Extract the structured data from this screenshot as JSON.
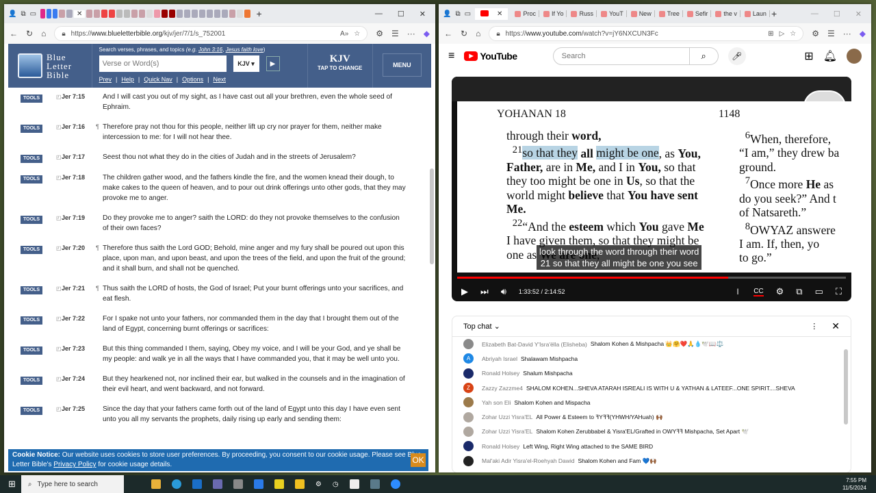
{
  "left_browser": {
    "url_prefix": "https://",
    "url_host": "www.blueletterbible.org",
    "url_path": "/kjv/jer/7/1/s_752001",
    "logo": [
      "Blue",
      "Letter",
      "Bible"
    ],
    "search_hint": "Search verses, phrases, and topics",
    "search_hint_eg": "(e.g.",
    "search_example1": "John 3:16",
    "search_example2": "Jesus faith love",
    "search_placeholder": "Verse or Word(s)",
    "version_select": "KJV ▾",
    "nav": [
      "Prev",
      "Help",
      "Quick Nav",
      "Options",
      "Next"
    ],
    "version_big": "KJV",
    "tap_to_change": "TAP TO CHANGE",
    "menu": "MENU",
    "tools_label": "TOOLS",
    "verses": [
      {
        "ref": "Jer 7:15",
        "para": "",
        "text": "And I will cast you out of my sight, as I have cast out all your brethren, even the whole seed of Ephraim."
      },
      {
        "ref": "Jer 7:16",
        "para": "¶",
        "text": "Therefore pray not thou for this people, neither lift up cry nor prayer for them, neither make intercession to me: for I will not hear thee."
      },
      {
        "ref": "Jer 7:17",
        "para": "",
        "text": "Seest thou not what they do in the cities of Judah and in the streets of Jerusalem?"
      },
      {
        "ref": "Jer 7:18",
        "para": "",
        "text": "The children gather wood, and the fathers kindle the fire, and the women knead their dough, to make cakes to the queen of heaven, and to pour out drink offerings unto other gods, that they may provoke me to anger."
      },
      {
        "ref": "Jer 7:19",
        "para": "",
        "text": "Do they provoke me to anger? saith the LORD: do they not provoke themselves to the confusion of their own faces?"
      },
      {
        "ref": "Jer 7:20",
        "para": "¶",
        "text": "Therefore thus saith the Lord GOD; Behold, mine anger and my fury shall be poured out upon this place, upon man, and upon beast, and upon the trees of the field, and upon the fruit of the ground; and it shall burn, and shall not be quenched."
      },
      {
        "ref": "Jer 7:21",
        "para": "¶",
        "text": "Thus saith the LORD of hosts, the God of Israel; Put your burnt offerings unto your sacrifices, and eat flesh."
      },
      {
        "ref": "Jer 7:22",
        "para": "",
        "text": "For I spake not unto your fathers, nor commanded them in the day that I brought them out of the land of Egypt, concerning burnt offerings or sacrifices:"
      },
      {
        "ref": "Jer 7:23",
        "para": "",
        "text": "But this thing commanded I them, saying, Obey my voice, and I will be your God, and ye shall be my people: and walk ye in all the ways that I have commanded you, that it may be well unto you."
      },
      {
        "ref": "Jer 7:24",
        "para": "",
        "text": "But they hearkened not, nor inclined their ear, but walked in the counsels and in the imagination of their evil heart, and went backward, and not forward."
      },
      {
        "ref": "Jer 7:25",
        "para": "",
        "text": "Since the day that your fathers came forth out of the land of Egypt unto this day I have even sent unto you all my servants the prophets, daily rising up early and sending them:"
      }
    ],
    "cookie_title": "Cookie Notice:",
    "cookie_text": "Our website uses cookies to store user preferences. By proceeding, you consent to our cookie usage. Please see Blue Letter Bible's",
    "cookie_link": "Privacy Policy",
    "cookie_tail": "for cookie usage details.",
    "cookie_ok": "OK"
  },
  "right_browser": {
    "tabs": [
      "Proc",
      "If Yo",
      "Russ",
      "YouT",
      "New",
      "Tree",
      "Sefir",
      "the v",
      "Laun"
    ],
    "url_prefix": "https://",
    "url_host": "www.youtube.com",
    "url_path": "/watch?v=jY6NXCUN3Fc",
    "brand": "YouTube",
    "search_placeholder": "Search",
    "video": {
      "page_header": "YOHANAN 18",
      "page_number": "1148",
      "col1_html": "through their <b>word,</b><br>&nbsp;&nbsp;<sup>21</sup><span class=\"hl\">so that they</span> <b>all</b> <span class=\"hl\">might be one</span>, as <b>You,<br>Father,</b> are in <b>Me,</b> and I in <b>You,</b> so that<br>they too might be one in <b>Us</b>, so that the<br>world might <b>believe</b> that <b>You have sent<br>Me.</b><br>&nbsp;&nbsp;<sup>22</sup>“And the <b>esteem</b> which <b>You</b> gave <b>Me</b><br>I have given them, so that they might be<br>one as <b>We are one</b>,",
      "col2_html": "&nbsp;&nbsp;<sup>6</sup>When, therefore,<br>“I am,” they drew ba<br>ground.<br>&nbsp;&nbsp;<sup>7</sup>Once more <b>He</b> as<br>do you seek?” And t<br>of Natsareth.”<br>&nbsp;&nbsp;<sup>8</sup>OWYAZ answere<br>I am. If, then, yo<br>to go.”",
      "caption_line1": "look through the word through their word",
      "caption_line2": "21 so that they all might be one you see",
      "current_time": "1:33:52",
      "duration": "2:14:52",
      "progress_fraction": 0.697
    },
    "chat": {
      "title": "Top chat",
      "messages": [
        {
          "author": "Elizabeth Bat-David Y'Isra'ëlla (Elisheba)",
          "text": "Shalom Kohen & Mishpacha 👑🤗❤️🙏💧🕊️📖⚖️",
          "avatar": "#8a8a8a",
          "initial": ""
        },
        {
          "author": "Abriyah Israel",
          "text": "Shalawam Mishpacha",
          "avatar": "#1e88e5",
          "initial": "A"
        },
        {
          "author": "Ronald Holsey",
          "text": "Shalum Mishpacha",
          "avatar": "#1a2a6a",
          "initial": ""
        },
        {
          "author": "Zazzy Zazzme4",
          "text": "SHALOM KOHEN...SHEVA ATARAH ISREALI IS WITH U & YATHAN & LATEEF...ONE SPIRIT....SHEVA",
          "avatar": "#d84315",
          "initial": "Z"
        },
        {
          "author": "Yah son Eli",
          "text": "Shalom Kohen and Mispacha",
          "avatar": "#9c7a4a",
          "initial": ""
        },
        {
          "author": "Zohar Uzzi Yisra'EL",
          "text": "All Power & Esteem to ꟻYꟻꟻ(YHWH/YAHuah) 🙌🏾",
          "avatar": "#b0a8a0",
          "initial": ""
        },
        {
          "author": "Zohar Uzzi Yisra'EL",
          "text": "Shalom Kohen Zerubbabel & Yisra'EL/Grafted in OWYꟻꟻ Mishpacha, Set Apart 🕊️",
          "avatar": "#b0a8a0",
          "initial": ""
        },
        {
          "author": "Ronald Holsey",
          "text": "Left Wing, Right Wing attached to the SAME BIRD",
          "avatar": "#1a2a6a",
          "initial": ""
        },
        {
          "author": "Mal'aki Adir Yisra'el-Roehyah Dawid",
          "text": "Shalom Kohen and Fam 💙🙌🏾",
          "avatar": "#222",
          "initial": ""
        }
      ]
    }
  },
  "taskbar": {
    "search_placeholder": "Type here to search",
    "time": "7:55 PM",
    "date": "11/5/2024"
  }
}
